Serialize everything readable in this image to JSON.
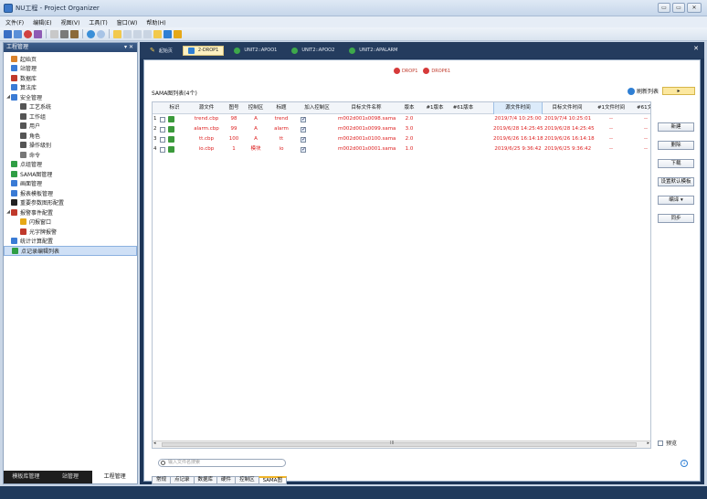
{
  "window": {
    "title": "NU工程 - Project Organizer",
    "minimize": "▭",
    "maximize": "▭",
    "close": "✕"
  },
  "menu": [
    "文件(F)",
    "编辑(E)",
    "视图(V)",
    "工具(T)",
    "窗口(W)",
    "帮助(H)"
  ],
  "left_panel": {
    "title": "工程管理",
    "pin": "▾ ✕",
    "tree": [
      {
        "label": "起始页",
        "indent": 0,
        "icon": "home-icon",
        "color": "#d9822b"
      },
      {
        "label": "站管理",
        "indent": 0,
        "icon": "station-icon",
        "color": "#3a7bd5"
      },
      {
        "label": "数据库",
        "indent": 0,
        "icon": "database-icon",
        "color": "#c0392b"
      },
      {
        "label": "算法库",
        "indent": 0,
        "icon": "algorithm-icon",
        "color": "#3a7bd5"
      },
      {
        "label": "安全管理",
        "indent": 0,
        "icon": "shield-icon",
        "color": "#3a7bd5",
        "expand": "◢"
      },
      {
        "label": "工艺系统",
        "indent": 1,
        "icon": "system-icon",
        "color": "#555"
      },
      {
        "label": "工作组",
        "indent": 1,
        "icon": "workgroup-icon",
        "color": "#555"
      },
      {
        "label": "用户",
        "indent": 1,
        "icon": "user-icon",
        "color": "#555"
      },
      {
        "label": "角色",
        "indent": 1,
        "icon": "role-icon",
        "color": "#555"
      },
      {
        "label": "操作级别",
        "indent": 1,
        "icon": "level-icon",
        "color": "#555"
      },
      {
        "label": "命令",
        "indent": 1,
        "icon": "command-icon",
        "color": "#777"
      },
      {
        "label": "点组管理",
        "indent": 0,
        "icon": "point-group-icon",
        "color": "#2f9e44"
      },
      {
        "label": "SAMA图管理",
        "indent": 0,
        "icon": "sama-icon",
        "color": "#2f9e44"
      },
      {
        "label": "画面管理",
        "indent": 0,
        "icon": "screen-icon",
        "color": "#3a7bd5"
      },
      {
        "label": "报表模板管理",
        "indent": 0,
        "icon": "report-icon",
        "color": "#3a7bd5"
      },
      {
        "label": "重要参数图形配置",
        "indent": 0,
        "icon": "param-icon",
        "color": "#222"
      },
      {
        "label": "报警事件配置",
        "indent": 0,
        "icon": "alarm-icon",
        "color": "#c0392b",
        "expand": "◢"
      },
      {
        "label": "闪报窗口",
        "indent": 1,
        "icon": "flash-icon",
        "color": "#e6a817"
      },
      {
        "label": "光字牌报警",
        "indent": 1,
        "icon": "light-alarm-icon",
        "color": "#c0392b"
      },
      {
        "label": "统计计算配置",
        "indent": 0,
        "icon": "stats-icon",
        "color": "#3a7bd5"
      },
      {
        "label": "点记录编辑列表",
        "indent": 0,
        "icon": "point-record-icon",
        "color": "#2f9e44",
        "selected": true
      }
    ],
    "bottom_tabs": [
      "模板库管理",
      "站管理",
      "工程管理"
    ]
  },
  "doc_tabs": [
    {
      "label": "起始页",
      "icon": "start-page-icon"
    },
    {
      "label": "2-DROP1",
      "icon": "drop-icon",
      "active": true
    },
    {
      "label": "UNIT2::APOO1",
      "icon": "unit-icon"
    },
    {
      "label": "UNIT2::APOO2",
      "icon": "unit-icon"
    },
    {
      "label": "UNIT2::APALARM",
      "icon": "unit-icon"
    }
  ],
  "drops": [
    "DROP1",
    "DROP61"
  ],
  "list": {
    "label": "SAMA图列表(4个)",
    "refresh": "刷新列表",
    "extra_button": "▸",
    "columns": [
      "标识",
      "源文件",
      "图号",
      "控制区",
      "标题",
      "加入控制区",
      "目标文件名称",
      "版本",
      "#1版本",
      "#61版本",
      "源文件时间",
      "目标文件时间",
      "#1文件时间",
      "#61文件"
    ],
    "rows": [
      {
        "idx": "1",
        "src": "trend.cbp",
        "no": "98",
        "area": "A",
        "title": "trend",
        "joined": true,
        "target": "m002d001s0098.sama",
        "ver": "2.0",
        "v1": "",
        "v61": "",
        "src_time": "2019/7/4 10:25:00",
        "tgt_time": "2019/7/4 10:25:01",
        "t1": "--",
        "t61": "--"
      },
      {
        "idx": "2",
        "src": "alarm.cbp",
        "no": "99",
        "area": "A",
        "title": "alarm",
        "joined": true,
        "target": "m002d001s0099.sama",
        "ver": "3.0",
        "v1": "",
        "v61": "",
        "src_time": "2019/6/28 14:25:45",
        "tgt_time": "2019/6/28 14:25:45",
        "t1": "--",
        "t61": "--"
      },
      {
        "idx": "3",
        "src": "tt.cbp",
        "no": "100",
        "area": "A",
        "title": "tt",
        "joined": true,
        "target": "m002d001s0100.sama",
        "ver": "2.0",
        "v1": "",
        "v61": "",
        "src_time": "2019/6/26 16:14:18",
        "tgt_time": "2019/6/26 16:14:18",
        "t1": "--",
        "t61": "--"
      },
      {
        "idx": "4",
        "src": "io.cbp",
        "no": "1",
        "area": "模块",
        "title": "io",
        "joined": true,
        "target": "m002d001s0001.sama",
        "ver": "1.0",
        "v1": "",
        "v61": "",
        "src_time": "2019/6/25 9:36:42",
        "tgt_time": "2019/6/25 9:36:42",
        "t1": "--",
        "t61": "--"
      }
    ]
  },
  "side_buttons": [
    "新建",
    "删除",
    "下载",
    "设置默认模板",
    "编译 ▾",
    "同步"
  ],
  "preview_label": "预览",
  "search_placeholder": "输入文件名搜索",
  "bottom_tabs": [
    "常规",
    "点记录",
    "数据库",
    "硬件",
    "控制区",
    "SAMA图"
  ],
  "active_bottom_tab": "SAMA图",
  "scroll_mark": "III"
}
